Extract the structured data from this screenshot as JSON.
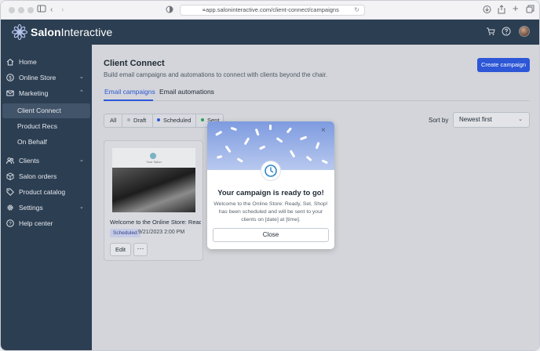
{
  "browser": {
    "url": "app.saloninteractive.com/client-connect/campaigns"
  },
  "app": {
    "brand_prefix": "Salon",
    "brand_suffix": "Interactive"
  },
  "sidebar": {
    "items": [
      {
        "label": "Home",
        "icon": "home-icon"
      },
      {
        "label": "Online Store",
        "icon": "dollar-icon",
        "chevron": "down"
      },
      {
        "label": "Marketing",
        "icon": "mail-icon",
        "chevron": "up"
      },
      {
        "label": "Client Connect",
        "sub": true,
        "active": true
      },
      {
        "label": "Product Recs",
        "sub": true
      },
      {
        "label": "On Behalf",
        "sub": true
      },
      {
        "label": "Clients",
        "icon": "users-icon",
        "chevron": "down"
      },
      {
        "label": "Salon orders",
        "icon": "box-icon"
      },
      {
        "label": "Product catalog",
        "icon": "tag-icon"
      },
      {
        "label": "Settings",
        "icon": "gear-icon",
        "chevron": "down"
      },
      {
        "label": "Help center",
        "icon": "help-icon"
      }
    ]
  },
  "main": {
    "title": "Client Connect",
    "subtitle": "Build email campaigns and automations to connect with clients beyond the chair.",
    "create_button": "Create campaign",
    "tabs": [
      {
        "label": "Email campaigns",
        "active": true
      },
      {
        "label": "Email automations",
        "active": false
      }
    ],
    "filters": [
      {
        "label": "All",
        "dot": ""
      },
      {
        "label": "Draft",
        "dot": "#a8adb5"
      },
      {
        "label": "Scheduled",
        "dot": "#2d57d6"
      },
      {
        "label": "Sent",
        "dot": "#27a05a"
      }
    ],
    "sort_label": "Sort by",
    "sort_value": "Newest first"
  },
  "card": {
    "thumb_caption": "Your Salon",
    "title": "Welcome to the Online Store: Ready, Set, Shop!",
    "title_display": "Welcome to the Online Store: Read...",
    "status": "Scheduled",
    "date": "9/21/2023 2:00 PM",
    "edit_label": "Edit",
    "more_label": "···"
  },
  "modal": {
    "title": "Your campaign is ready to go!",
    "body": "Welcome to the Online Store: Ready, Set, Shop! has been scheduled and will be sent to your clients on [date] at [time].",
    "close_label": "Close",
    "close_icon": "×"
  },
  "colors": {
    "sidebar": "#2c3e52",
    "primary": "#2d57d6",
    "scheduled_badge": "#c5cbe6"
  }
}
